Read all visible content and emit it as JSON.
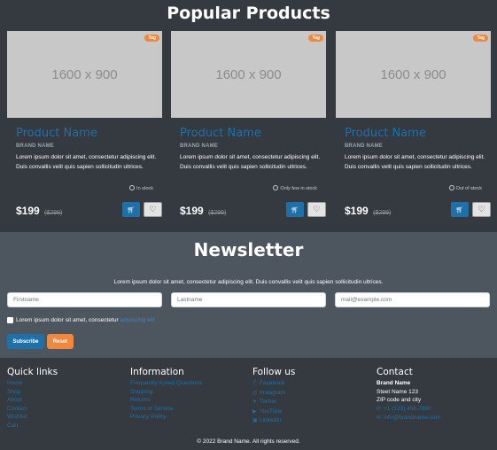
{
  "products_section": {
    "title": "Popular Products",
    "items": [
      {
        "image_placeholder": "1600 x 900",
        "tag": "Tag",
        "name": "Product Name",
        "brand": "BRAND NAME",
        "description": "Lorem ipsum dolor sit amet, consectetur adipiscing elit. Duis convallis velit quis sapien sollicitudin ultrices.",
        "stock": "In stock",
        "price": "$199",
        "old_price": "($299)",
        "cart_icon": "cart-icon",
        "wish_icon": "heart-icon"
      },
      {
        "image_placeholder": "1600 x 900",
        "tag": "Tag",
        "name": "Product Name",
        "brand": "BRAND NAME",
        "description": "Lorem ipsum dolor sit amet, consectetur adipiscing elit. Duis convallis velit quis sapien sollicitudin ultrices.",
        "stock": "Only few in stock",
        "price": "$199",
        "old_price": "($299)",
        "cart_icon": "cart-icon",
        "wish_icon": "heart-icon"
      },
      {
        "image_placeholder": "1600 x 900",
        "tag": "Tag",
        "name": "Product Name",
        "brand": "BRAND NAME",
        "description": "Lorem ipsum dolor sit amet, consectetur adipiscing elit. Duis convallis velit quis sapien sollicitudin ultrices.",
        "stock": "Out of stock",
        "price": "$199",
        "old_price": "($299)",
        "cart_icon": "cart-icon",
        "wish_icon": "heart-icon"
      }
    ]
  },
  "newsletter": {
    "title": "Newsletter",
    "text": "Lorem ipsum dolor sit amet, consectetur adipiscing elit. Duis convallis velit quis sapien sollicitudin ultrices.",
    "firstname_placeholder": "Firstname",
    "lastname_placeholder": "Lastname",
    "email_placeholder": "mail@example.com",
    "checkbox_label": "Lorem ipsum dolor sit amet, consectetur",
    "checkbox_link": "adipiscing elit",
    "subscribe_label": "Subscribe",
    "reset_label": "Reset"
  },
  "footer": {
    "quick_links": {
      "title": "Quick links",
      "links": [
        "Home",
        "Shop",
        "About",
        "Contact",
        "Wishlist",
        "Cart"
      ]
    },
    "information": {
      "title": "Information",
      "links": [
        "Frequently Asked Questions",
        "Shipping",
        "Returns",
        "Terms of Service",
        "Privacy Policy"
      ]
    },
    "follow_us": {
      "title": "Follow us",
      "links": [
        {
          "icon": "facebook-icon",
          "label": "Facebook"
        },
        {
          "icon": "instagram-icon",
          "label": "Instagram"
        },
        {
          "icon": "twitter-icon",
          "label": "Twitter"
        },
        {
          "icon": "youtube-icon",
          "label": "YouTube"
        },
        {
          "icon": "linkedin-icon",
          "label": "LinkedIn"
        }
      ]
    },
    "contact": {
      "title": "Contact",
      "company": "Brand Name",
      "street": "Steet Name 123",
      "city": "ZIP code and city",
      "phone_icon": "phone-icon",
      "phone": "+1 (123) 456-7890",
      "email_icon": "mail-icon",
      "email": "info@brandname.com"
    },
    "copyright": "© 2022 Brand Name. All rights reserved."
  },
  "colors": {
    "dark_bg": "#353a40",
    "newsletter_bg": "#4d565e",
    "primary": "#1f6fa8",
    "accent": "#f0883e"
  }
}
